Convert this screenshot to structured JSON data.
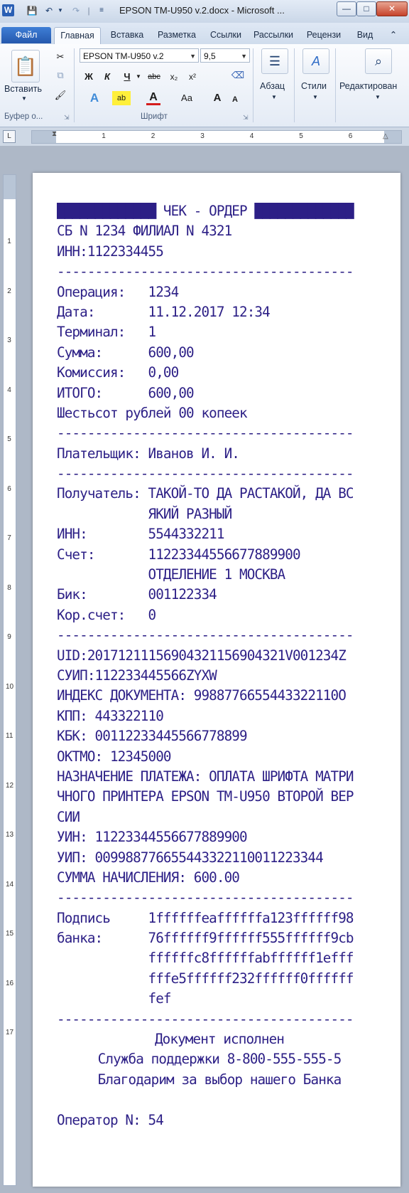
{
  "window": {
    "title": "EPSON TM-U950 v.2.docx - Microsoft ...",
    "app_icon": "W",
    "controls": {
      "minimize": "—",
      "maximize": "□",
      "close": "✕"
    }
  },
  "ribbon": {
    "tabs": [
      "Файл",
      "Главная",
      "Вставка",
      "Разметка",
      "Ссылки",
      "Рассылки",
      "Рецензи",
      "Вид"
    ],
    "clipboard": {
      "paste_label": "Вставить",
      "group_label": "Буфер о..."
    },
    "font": {
      "font_name": "EPSON TM-U950 v.2",
      "font_size": "9,5",
      "bold": "Ж",
      "italic": "К",
      "underline": "Ч",
      "strike": "abc",
      "subscript": "x₂",
      "superscript": "x²",
      "change_case": "Aa",
      "grow": "A",
      "shrink": "A",
      "group_label": "Шрифт"
    },
    "paragraph": {
      "label": "Абзац"
    },
    "styles": {
      "label": "Стили"
    },
    "editing": {
      "label": "Редактирован"
    }
  },
  "ruler": {
    "horizontal_marks": [
      "1",
      "2",
      "3",
      "4",
      "5",
      "6"
    ],
    "vertical_marks": [
      "1",
      "2",
      "3",
      "4",
      "5",
      "6",
      "7",
      "8",
      "9",
      "10",
      "11",
      "12",
      "13",
      "14",
      "15",
      "16",
      "17"
    ]
  },
  "document": {
    "lines": [
      "█████████████ ЧЕК - ОРДЕР █████████████",
      "СБ N 1234 ФИЛИАЛ N 4321",
      "ИНН:1122334455",
      "---------------------------------------",
      "Операция:   1234",
      "Дата:       11.12.2017 12:34",
      "Терминал:   1",
      "Сумма:      600,00",
      "Комиссия:   0,00",
      "ИТОГО:      600,00",
      "Шестьсот рублей 00 копеек",
      "---------------------------------------",
      "Плательщик: Иванов И. И.",
      "---------------------------------------",
      "Получатель: ТАКОЙ-ТО ДА РАСТАКОЙ, ДА ВС",
      "            ЯКИЙ РАЗНЫЙ",
      "ИНН:        5544332211",
      "Счет:       11223344556677889900",
      "            ОТДЕЛЕНИЕ 1 МОСКВА",
      "Бик:        001122334",
      "Кор.счет:   0",
      "---------------------------------------",
      "UID:20171211156904321156904321V001234Z",
      "СУИП:112233445566ZYXW",
      "ИНДЕКС ДОКУМЕНТА: 9988776655443322110O",
      "КПП: 443322110",
      "КБК: 00112233445566778899",
      "ОКТМО: 12345000",
      "НАЗНАЧЕНИЕ ПЛАТЕЖА: ОПЛАТА ШРИФТА МАТРИ",
      "ЧНОГО ПРИНТЕРА EPSON TM-U950 ВТОРОЙ ВЕР",
      "СИИ",
      "УИН: 11223344556677889900",
      "УИП: 0099887766554433221100112233​44",
      "СУММА НАЧИСЛЕНИЯ: 600.00",
      "---------------------------------------",
      "Подпись     1ffffffeaffffffa123ffffff98",
      "банка:      76ffffff9ffffff555ffffff9cb",
      "            ffffffc8ffffffabffffff1efff",
      "            fffe5ffffff232ffffff0ffffff",
      "            fef",
      "---------------------------------------"
    ],
    "footer": {
      "done": "Документ исполнен",
      "support": "Служба поддержки 8-800-555-555-5",
      "thanks": "Благодарим за выбор нашего Банка",
      "operator": "Оператор N: 54"
    }
  }
}
